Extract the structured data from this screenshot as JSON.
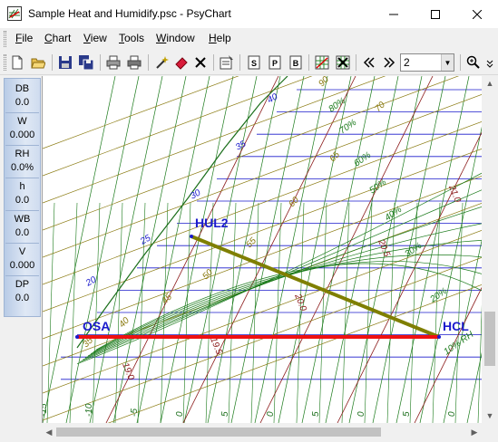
{
  "window": {
    "title": "Sample Heat and Humidify.psc - PsyChart",
    "icon": "psychart-app-icon"
  },
  "menu": [
    "File",
    "Chart",
    "View",
    "Tools",
    "Window",
    "Help"
  ],
  "toolbar": {
    "icons": [
      "new-icon",
      "open-icon",
      "save-icon",
      "save-all-icon",
      "print-icon",
      "print-preview-icon",
      "wand-icon",
      "eraser-icon",
      "delete-icon",
      "properties-icon",
      "page-s-icon",
      "page-p-icon",
      "page-b-icon",
      "chart-grid-icon",
      "chart-clear-icon",
      "previous-icon",
      "next-icon",
      "zoom-icon"
    ],
    "page_value": "2"
  },
  "readout": [
    {
      "label": "DB",
      "value": "0.0"
    },
    {
      "label": "W",
      "value": "0.000"
    },
    {
      "label": "RH",
      "value": "0.0%"
    },
    {
      "label": "h",
      "value": "0.0"
    },
    {
      "label": "WB",
      "value": "0.0"
    },
    {
      "label": "V",
      "value": "0.000"
    },
    {
      "label": "DP",
      "value": "0.0"
    }
  ],
  "chart": {
    "points": [
      {
        "name": "HUL2",
        "color": "#1a1acc"
      },
      {
        "name": "OSA",
        "color": "#1a1acc"
      },
      {
        "name": "HCL",
        "color": "#1a1acc"
      }
    ],
    "processes": [
      {
        "from": "HUL2",
        "to": "HCL",
        "color": "#7f7f00"
      },
      {
        "from": "OSA",
        "to": "HCL",
        "color": "#ee1111"
      }
    ],
    "saturation_labels": [
      "40",
      "35",
      "30",
      "25",
      "20"
    ],
    "enthalpy_labels": [
      "90",
      "70",
      "65",
      "60",
      "55",
      "50",
      "45",
      "40",
      "35"
    ],
    "rh_labels": [
      "80%",
      "70%",
      "60%",
      "50%",
      "40%",
      "30%",
      "20%",
      "10% RH"
    ],
    "volume_labels": [
      "21.0",
      "20.5",
      "20.0",
      "19.5",
      "19.0"
    ],
    "bottom_tick_labels": [
      "-15",
      "-10",
      "-5",
      "0",
      "5",
      "0",
      "5",
      "0",
      "5",
      "0"
    ],
    "colors": {
      "saturation_grid": "#1a6e1a",
      "enthalpy": "#8a7a10",
      "volume": "#8b1a1a",
      "humidity": "#1a1acc",
      "rh": "#1a7a1a"
    }
  }
}
